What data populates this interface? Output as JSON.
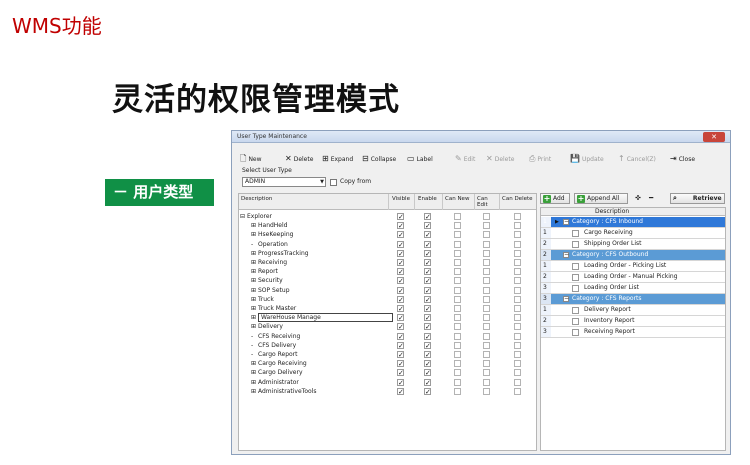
{
  "slide": {
    "header": "WMS功能",
    "title": "灵活的权限管理模式",
    "section_label": "－ 用户类型"
  },
  "window": {
    "title": "User Type Maintenance",
    "close_glyph": "✕"
  },
  "toolbar": [
    {
      "label": "New",
      "icon": "🗋",
      "enabled": true
    },
    {
      "label": "Delete",
      "icon": "✕",
      "enabled": true
    },
    {
      "label": "Expand",
      "icon": "⊞",
      "enabled": true
    },
    {
      "label": "Collapse",
      "icon": "⊟",
      "enabled": true
    },
    {
      "label": "Label",
      "icon": "▭",
      "enabled": true
    },
    {
      "label": "Edit",
      "icon": "✎",
      "enabled": false
    },
    {
      "label": "Delete",
      "icon": "✕",
      "enabled": false
    },
    {
      "label": "Print",
      "icon": "⎙",
      "enabled": false
    },
    {
      "label": "Update",
      "icon": "💾",
      "enabled": false
    },
    {
      "label": "Cancel(Z)",
      "icon": "↑",
      "enabled": false
    },
    {
      "label": "Close",
      "icon": "⇥",
      "enabled": true
    }
  ],
  "user_type": {
    "label": "Select User Type",
    "value": "ADMIN",
    "copy_from_label": "Copy from"
  },
  "left_grid": {
    "columns": [
      "Description",
      "Visible",
      "Enable",
      "Can New",
      "Can Edit",
      "Can Delete"
    ],
    "rows": [
      {
        "prefix": "⊟",
        "text": "Explorer",
        "visible": true,
        "enable": true
      },
      {
        "prefix": "⊞",
        "text": "HandHeld",
        "visible": true,
        "enable": true
      },
      {
        "prefix": "⊞",
        "text": "HseKeeping",
        "visible": true,
        "enable": true
      },
      {
        "prefix": "-",
        "text": "Operation",
        "visible": true,
        "enable": true
      },
      {
        "prefix": "⊞",
        "text": "ProgressTracking",
        "visible": true,
        "enable": true
      },
      {
        "prefix": "⊞",
        "text": "Receiving",
        "visible": true,
        "enable": true
      },
      {
        "prefix": "⊞",
        "text": "Report",
        "visible": true,
        "enable": true
      },
      {
        "prefix": "⊞",
        "text": "Security",
        "visible": true,
        "enable": true
      },
      {
        "prefix": "⊞",
        "text": "SOP Setup",
        "visible": true,
        "enable": true
      },
      {
        "prefix": "⊞",
        "text": "Truck",
        "visible": true,
        "enable": true
      },
      {
        "prefix": "⊞",
        "text": "Truck Master",
        "visible": true,
        "enable": true
      },
      {
        "prefix": "⊞",
        "text": "WareHouse Manage",
        "visible": true,
        "enable": true,
        "selected": true
      },
      {
        "prefix": "⊞",
        "text": "Delivery",
        "visible": true,
        "enable": true
      },
      {
        "prefix": "-",
        "text": "CFS Receiving",
        "visible": true,
        "enable": true
      },
      {
        "prefix": "-",
        "text": "CFS Delivery",
        "visible": true,
        "enable": true
      },
      {
        "prefix": "-",
        "text": "Cargo Report",
        "visible": true,
        "enable": true
      },
      {
        "prefix": "⊞",
        "text": "Cargo Receiving",
        "visible": true,
        "enable": true
      },
      {
        "prefix": "⊞",
        "text": "Cargo Delivery",
        "visible": true,
        "enable": true
      },
      {
        "prefix": "⊞",
        "text": "Administrator",
        "visible": true,
        "enable": true
      },
      {
        "prefix": "⊞",
        "text": "AdministrativeTools",
        "visible": true,
        "enable": true
      }
    ]
  },
  "right_panel": {
    "add_label": "Add",
    "append_label": "Append All",
    "up_glyph": "✜",
    "down_glyph": "━",
    "retrieve_label": "Retrieve",
    "column": "Description",
    "rows": [
      {
        "num": "1",
        "type": "category",
        "text": "Category : CFS Inbound",
        "current": true
      },
      {
        "num": "1",
        "type": "item",
        "text": "Cargo Receiving"
      },
      {
        "num": "2",
        "type": "item",
        "text": "Shipping Order List"
      },
      {
        "num": "2",
        "type": "category",
        "text": "Category : CFS Outbound"
      },
      {
        "num": "1",
        "type": "item",
        "text": "Loading Order - Picking List"
      },
      {
        "num": "2",
        "type": "item",
        "text": "Loading Order - Manual Picking"
      },
      {
        "num": "3",
        "type": "item",
        "text": "Loading Order List"
      },
      {
        "num": "3",
        "type": "category",
        "text": "Category : CFS Reports"
      },
      {
        "num": "1",
        "type": "item",
        "text": "Delivery Report"
      },
      {
        "num": "2",
        "type": "item",
        "text": "Inventory Report"
      },
      {
        "num": "3",
        "type": "item",
        "text": "Receiving Report"
      }
    ]
  }
}
